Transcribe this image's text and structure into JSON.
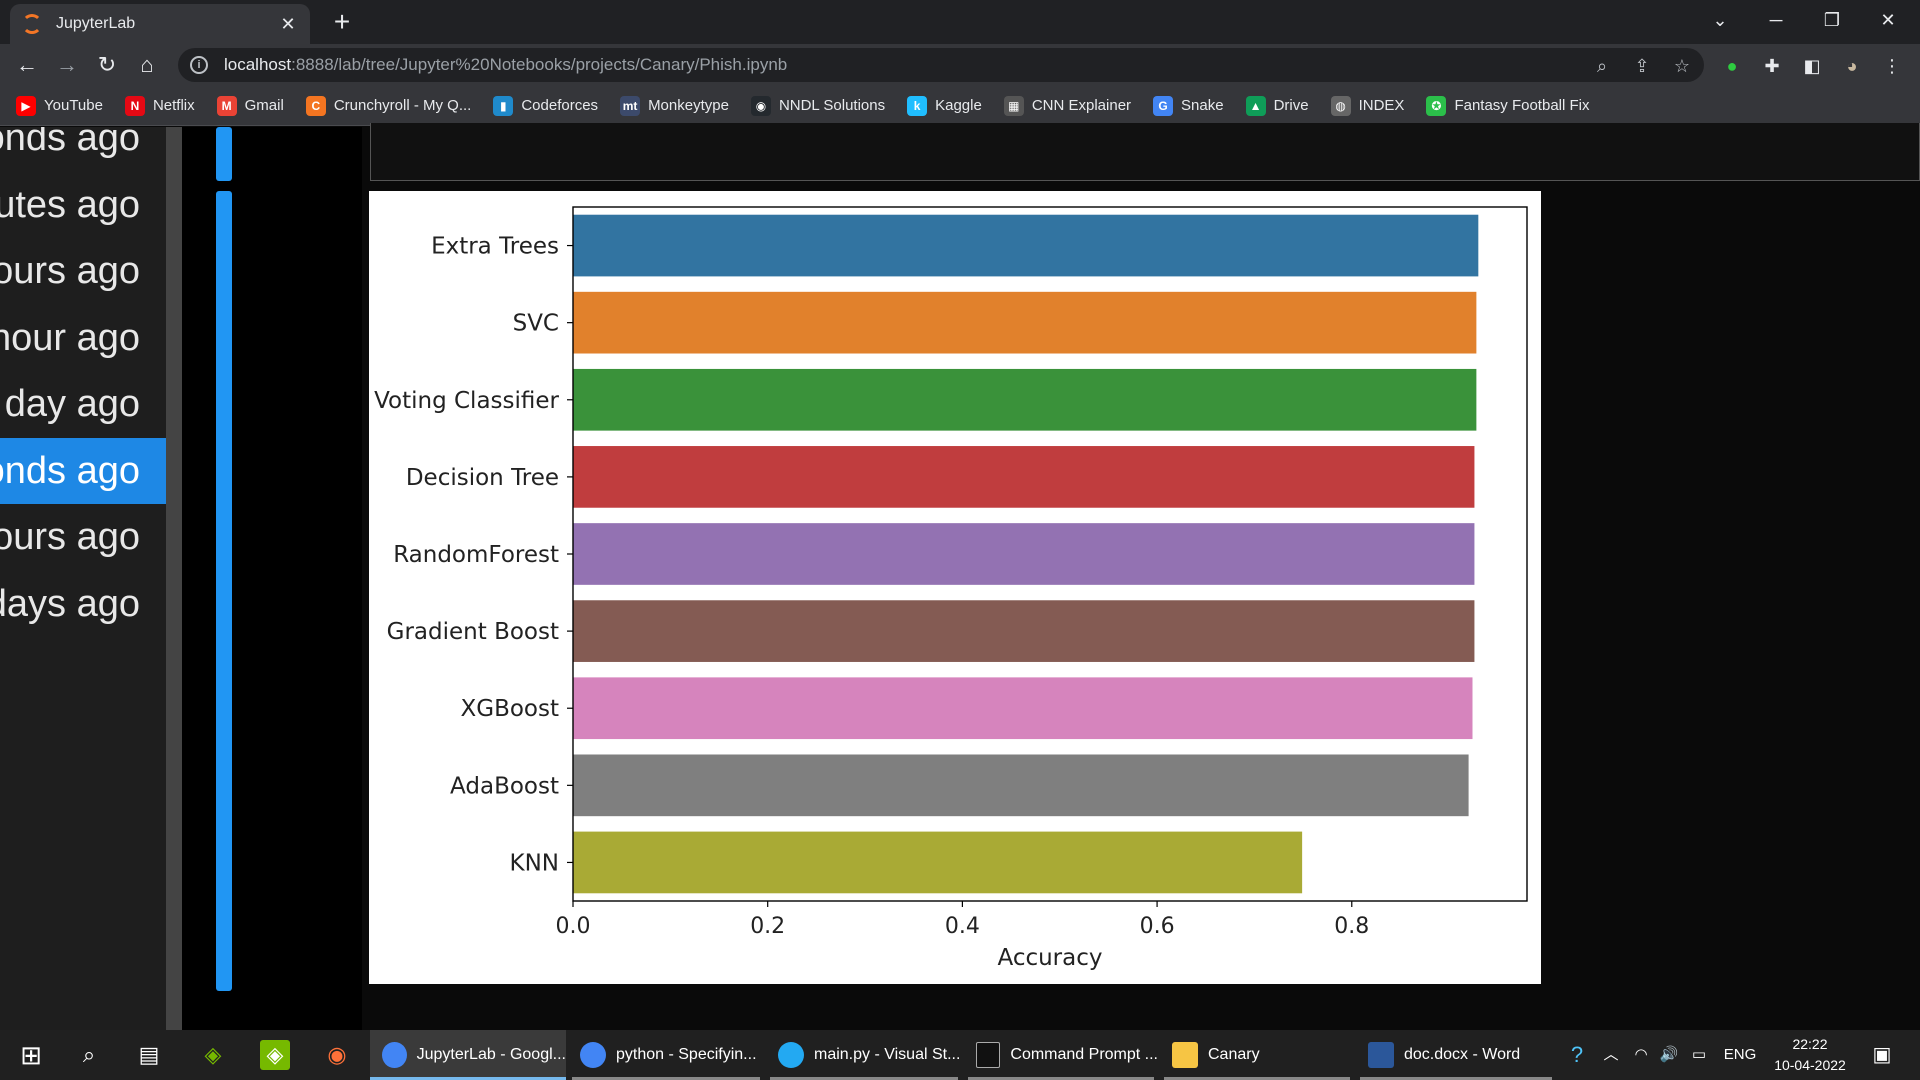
{
  "browser": {
    "tab_title": "JupyterLab",
    "tab_close": "✕",
    "new_tab": "+",
    "url_host": "localhost",
    "url_path": ":8888/lab/tree/Jupyter%20Notebooks/projects/Canary/Phish.ipynb",
    "bookmarks": [
      {
        "label": "YouTube",
        "color": "#ff0000",
        "glyph": "▶"
      },
      {
        "label": "Netflix",
        "color": "#e50914",
        "glyph": "N"
      },
      {
        "label": "Gmail",
        "color": "#ea4335",
        "glyph": "M"
      },
      {
        "label": "Crunchyroll - My Q...",
        "color": "#f47521",
        "glyph": "C"
      },
      {
        "label": "Codeforces",
        "color": "#1f8acb",
        "glyph": "▮"
      },
      {
        "label": "Monkeytype",
        "color": "#3c4a6b",
        "glyph": "mt"
      },
      {
        "label": "NNDL Solutions",
        "color": "#24292e",
        "glyph": "◉"
      },
      {
        "label": "Kaggle",
        "color": "#20beff",
        "glyph": "k"
      },
      {
        "label": "CNN Explainer",
        "color": "#555555",
        "glyph": "▦"
      },
      {
        "label": "Snake",
        "color": "#4285f4",
        "glyph": "G"
      },
      {
        "label": "Drive",
        "color": "#0f9d58",
        "glyph": "▲"
      },
      {
        "label": "INDEX",
        "color": "#666666",
        "glyph": "◍"
      },
      {
        "label": "Fantasy Football Fix",
        "color": "#2bbf4a",
        "glyph": "✪"
      }
    ]
  },
  "sidebar": {
    "items": [
      {
        "label": "onds ago",
        "selected": false
      },
      {
        "label": "utes ago",
        "selected": false
      },
      {
        "label": "ours ago",
        "selected": false
      },
      {
        "label": "hour ago",
        "selected": false
      },
      {
        "label": "day ago",
        "selected": false
      },
      {
        "label": "onds ago",
        "selected": true
      },
      {
        "label": "ours ago",
        "selected": false
      },
      {
        "label": "days ago",
        "selected": false
      }
    ]
  },
  "chart_data": {
    "type": "bar",
    "orientation": "horizontal",
    "categories": [
      "Extra Trees",
      "SVC",
      "Voting Classifier",
      "Decision Tree",
      "RandomForest",
      "Gradient Boost",
      "XGBoost",
      "AdaBoost",
      "KNN"
    ],
    "values": [
      0.93,
      0.928,
      0.928,
      0.926,
      0.926,
      0.926,
      0.924,
      0.92,
      0.749
    ],
    "colors": [
      "#3274a1",
      "#e1812c",
      "#3a923a",
      "#c03d3e",
      "#9372b2",
      "#845b53",
      "#d684bd",
      "#7f7f7f",
      "#a9aa35"
    ],
    "xlabel": "Accuracy",
    "ylabel": "",
    "xlim": [
      0,
      0.98
    ],
    "xticks": [
      0.0,
      0.2,
      0.4,
      0.6,
      0.8
    ],
    "xtick_labels": [
      "0.0",
      "0.2",
      "0.4",
      "0.6",
      "0.8"
    ],
    "grid": false
  },
  "taskbar": {
    "apps": [
      {
        "label": "JupyterLab - Googl...",
        "active": true
      },
      {
        "label": "python - Specifyin...",
        "active": false
      },
      {
        "label": "main.py - Visual St...",
        "active": false
      },
      {
        "label": "Command Prompt ...",
        "active": false
      },
      {
        "label": "Canary",
        "active": false
      },
      {
        "label": "doc.docx - Word",
        "active": false
      }
    ],
    "language": "ENG",
    "time": "22:22",
    "date": "10-04-2022"
  }
}
